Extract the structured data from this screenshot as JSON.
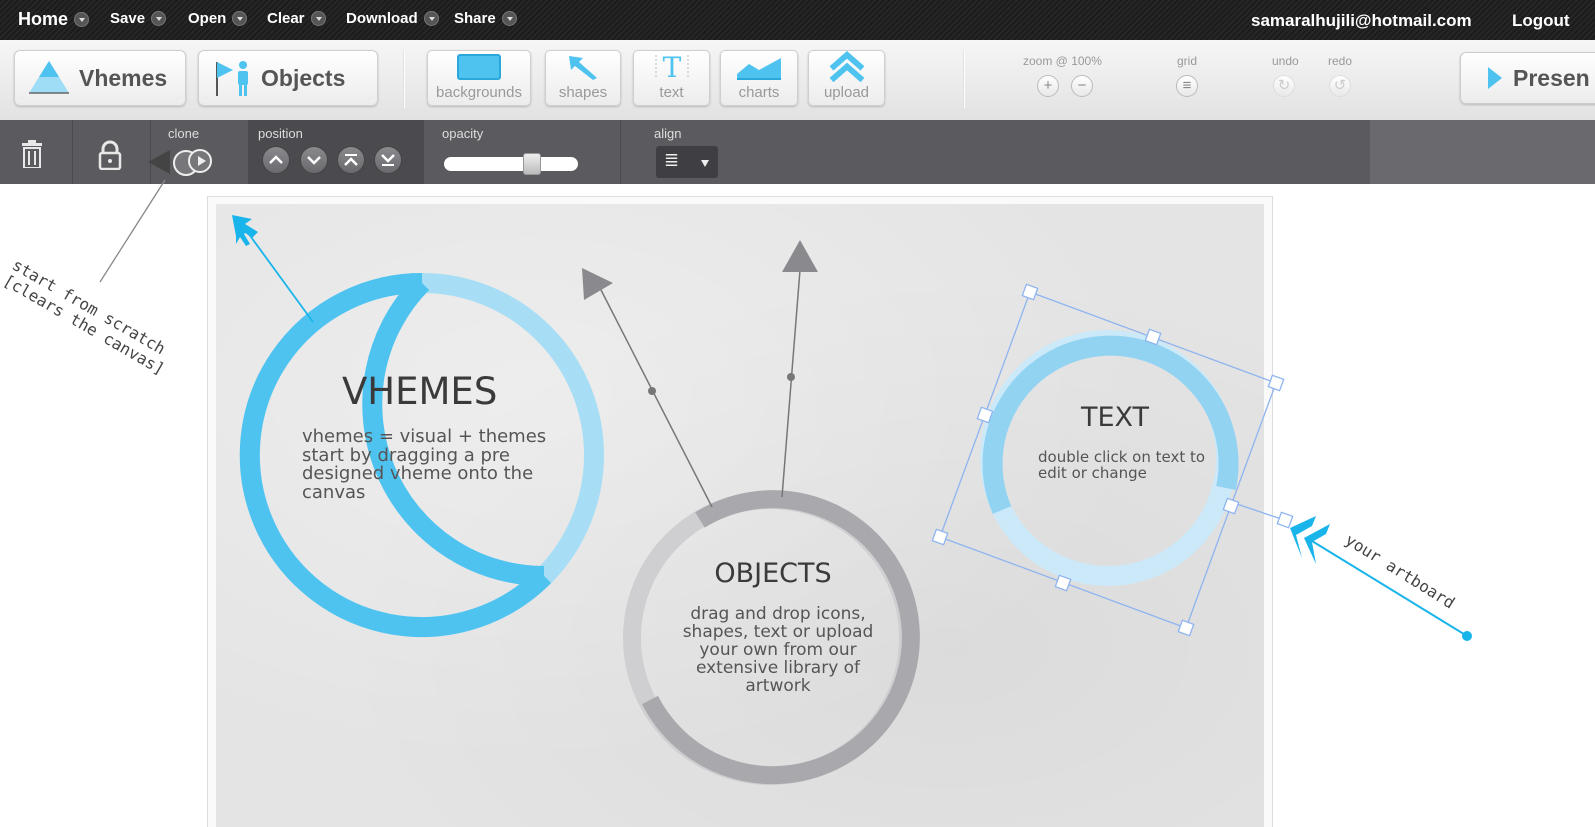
{
  "menu": {
    "home": "Home",
    "save": "Save",
    "open": "Open",
    "clear": "Clear",
    "download": "Download",
    "share": "Share",
    "user_email": "samaralhujili@hotmail.com",
    "logout": "Logout"
  },
  "toolbar": {
    "vhemes": "Vhemes",
    "objects": "Objects",
    "tools": {
      "backgrounds": "backgrounds",
      "shapes": "shapes",
      "text": "text",
      "charts": "charts",
      "upload": "upload"
    },
    "zoom_label": "zoom @ 100%",
    "zoom_in": "+",
    "zoom_out": "−",
    "grid_label": "grid",
    "grid_icon": "≡",
    "undo_label": "undo",
    "redo_label": "redo",
    "undo_icon": "↻",
    "redo_icon": "↺",
    "present": "Presen"
  },
  "propbar": {
    "clone_label": "clone",
    "position_label": "position",
    "opacity_label": "opacity",
    "opacity_value": 0.68,
    "align_label": "align",
    "align_value": "≣"
  },
  "canvas": {
    "vhemes": {
      "title": "VHEMES",
      "body": "vhemes = visual + themes start by dragging a pre designed vheme onto the canvas"
    },
    "objects": {
      "title": "OBJECTS",
      "body": "drag and drop icons, shapes, text or upload your own from our extensive library of artwork"
    },
    "text": {
      "title": "TEXT",
      "body": "double click on text to edit or change"
    }
  },
  "annotations": {
    "scratch": "start from scratch\n[clears the canvas]",
    "artboard": "your artboard"
  },
  "colors": {
    "accent_blue": "#4fc3f0",
    "light_blue": "#a8def5",
    "ring_gray": "#a9a9ad",
    "ring_light_gray": "#cfcfd2",
    "arrow_cyan": "#19b5ea",
    "selection": "#8eb4f0"
  }
}
